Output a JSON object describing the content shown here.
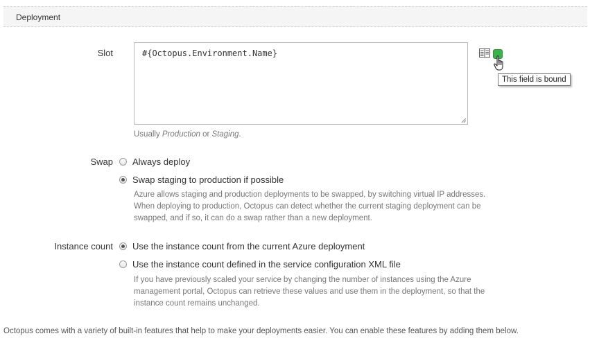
{
  "section": {
    "title": "Deployment"
  },
  "slot": {
    "label": "Slot",
    "value": "#{Octopus.Environment.Name}",
    "help_prefix": "Usually ",
    "help_production": "Production",
    "help_or": " or ",
    "help_staging": "Staging",
    "help_suffix": ".",
    "tooltip": "This field is bound",
    "bind_icon": "variable-binding-icon",
    "bound_color": "#3db14b"
  },
  "swap": {
    "label": "Swap",
    "options": [
      {
        "label": "Always deploy",
        "selected": false
      },
      {
        "label": "Swap staging to production if possible",
        "selected": true
      }
    ],
    "help": [
      "Azure allows staging and production deployments to be swapped, by switching virtual IP addresses.",
      "When deploying to production, Octopus can detect whether the current staging deployment can be",
      "swapped, and if so, it can do a swap rather than a new deployment."
    ]
  },
  "instance_count": {
    "label": "Instance count",
    "options": [
      {
        "label": "Use the instance count from the current Azure deployment",
        "selected": true
      },
      {
        "label": "Use the instance count defined in the service configuration XML file",
        "selected": false
      }
    ],
    "help": [
      "If you have previously scaled your service by changing the number of instances using the Azure",
      "management portal, Octopus can retrieve these values and use them in the deployment, so that the",
      "instance count remains unchanged."
    ]
  },
  "footer": {
    "text": "Octopus comes with a variety of built-in features that help to make your deployments easier. You can enable these features by adding them below."
  }
}
